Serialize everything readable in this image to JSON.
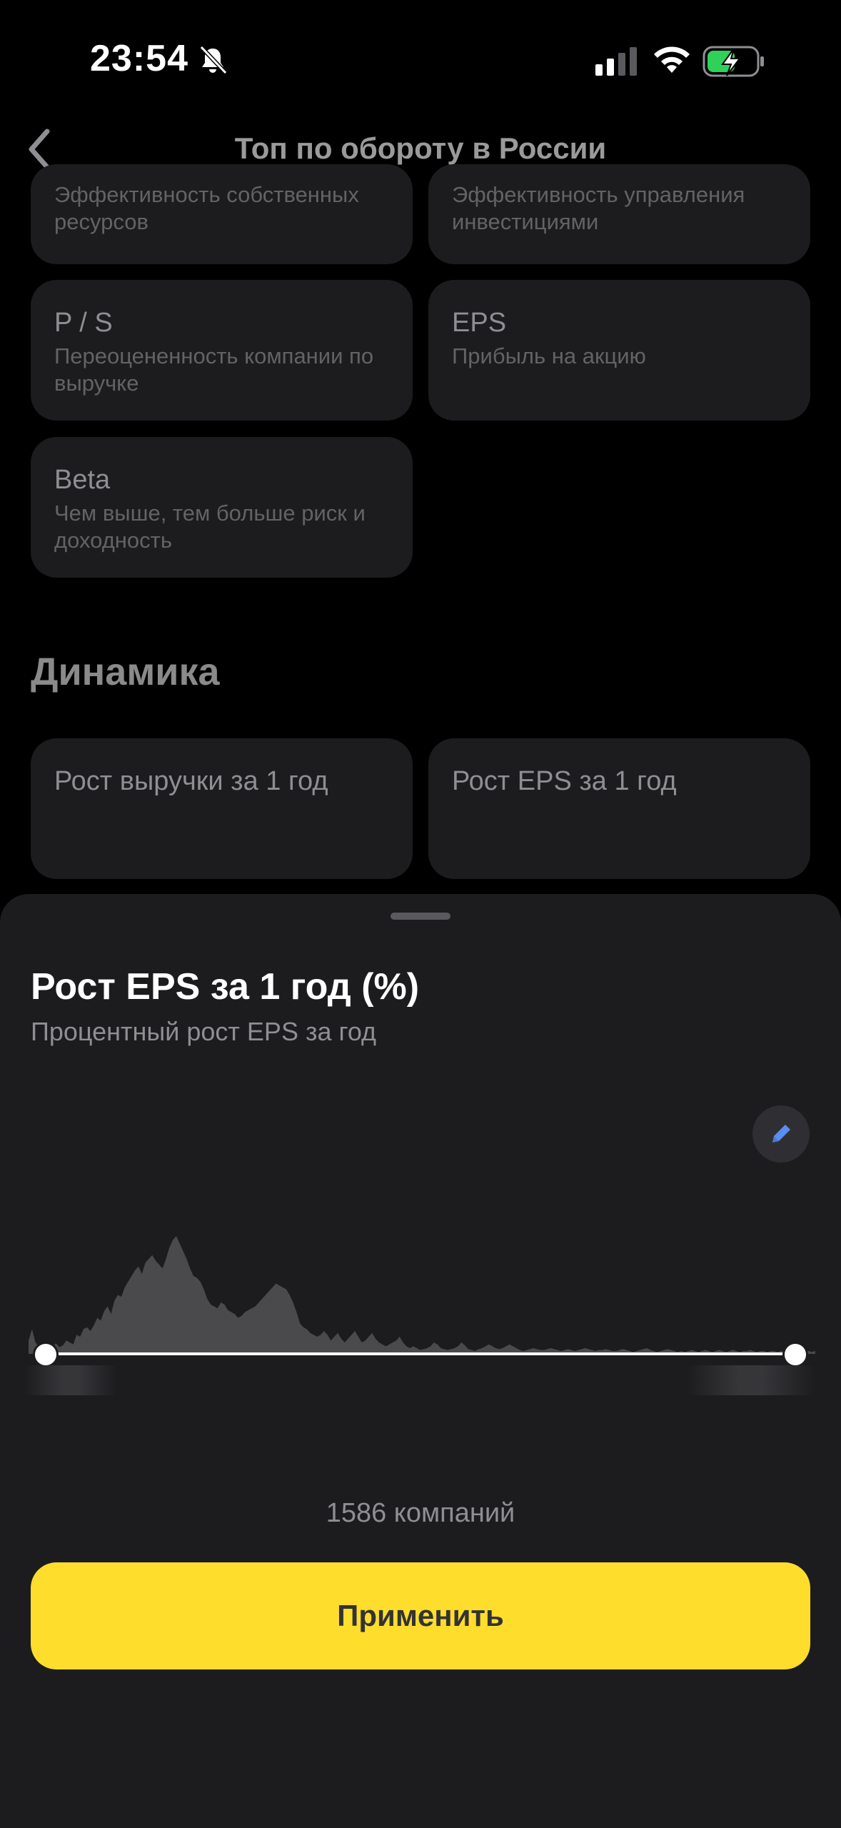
{
  "status_bar": {
    "time": "23:54"
  },
  "header": {
    "title": "Топ по обороту в России"
  },
  "cards": [
    {
      "subtitle": "Эффективность собственных ресурсов"
    },
    {
      "subtitle": "Эффективность управления инвестициями"
    },
    {
      "title": "P / S",
      "subtitle": "Переоцененность компании по выручке"
    },
    {
      "title": "EPS",
      "subtitle": "Прибыль на акцию"
    },
    {
      "title": "Beta",
      "subtitle": "Чем выше, тем больше риск и доходность"
    }
  ],
  "dynamics": {
    "heading": "Динамика",
    "cards": [
      {
        "title": "Рост выручки за 1 год"
      },
      {
        "title": "Рост EPS за 1 год"
      }
    ]
  },
  "sheet": {
    "title": "Рост EPS за 1 год (%)",
    "subtitle": "Процентный рост EPS за год",
    "companies": "1586 компаний",
    "apply_label": "Применить",
    "range_min_label": "",
    "range_max_label": ""
  },
  "chart_data": {
    "type": "area",
    "values": [
      14,
      26,
      12,
      8,
      6,
      5,
      6,
      8,
      11,
      7,
      9,
      14,
      12,
      10,
      20,
      18,
      26,
      28,
      24,
      30,
      38,
      35,
      45,
      50,
      42,
      56,
      62,
      60,
      70,
      76,
      82,
      88,
      92,
      84,
      96,
      100,
      104,
      98,
      94,
      90,
      100,
      112,
      120,
      124,
      116,
      108,
      100,
      90,
      82,
      80,
      76,
      68,
      58,
      52,
      50,
      48,
      54,
      52,
      46,
      44,
      42,
      38,
      40,
      44,
      46,
      48,
      50,
      54,
      58,
      62,
      66,
      70,
      74,
      72,
      70,
      68,
      62,
      54,
      44,
      32,
      28,
      26,
      22,
      20,
      18,
      20,
      24,
      20,
      14,
      18,
      22,
      16,
      12,
      16,
      20,
      24,
      18,
      12,
      14,
      18,
      22,
      16,
      12,
      10,
      8,
      10,
      12,
      14,
      18,
      12,
      8,
      6,
      8,
      6,
      4,
      5,
      6,
      8,
      12,
      10,
      6,
      5,
      4,
      5,
      6,
      8,
      12,
      9,
      5,
      4,
      3,
      5,
      6,
      8,
      10,
      8,
      6,
      5,
      6,
      8,
      10,
      8,
      6,
      4,
      3,
      4,
      5,
      6,
      5,
      4,
      4,
      5,
      6,
      5,
      4,
      3,
      4,
      5,
      4,
      3,
      4,
      5,
      6,
      5,
      4,
      3,
      4,
      4,
      5,
      4,
      3,
      3,
      4,
      5,
      4,
      3,
      2,
      3,
      4,
      5,
      6,
      4,
      3,
      2,
      3,
      4,
      5,
      4,
      3,
      2,
      3,
      2,
      3,
      4,
      3,
      2,
      3,
      4,
      3,
      2,
      3,
      4,
      3,
      2,
      3,
      4,
      3,
      2,
      3,
      3,
      4,
      3,
      2,
      3,
      3,
      2,
      3,
      3,
      2,
      3,
      3,
      2,
      3,
      3,
      3,
      2,
      3,
      3,
      2,
      3
    ],
    "grid": false,
    "legend": "none",
    "fill_color": "#4a4a4c",
    "color": "#ffffff"
  },
  "colors": {
    "background": "#000000",
    "card": "#1c1c1e",
    "sheet": "#1c1c1e",
    "accent": "#ffdd2d",
    "edit_icon": "#5b8def",
    "battery": "#30d158"
  }
}
